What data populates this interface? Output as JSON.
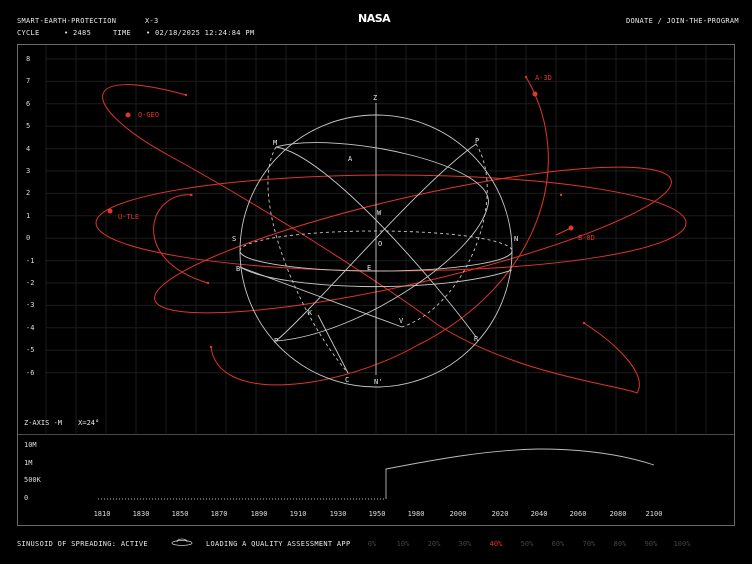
{
  "header": {
    "app_title": "SMART-EARTH-PROTECTION",
    "code": "X-3",
    "cycle_label": "CYCLE",
    "cycle_value": "• 2485",
    "time_label": "TIME",
    "time_value": "• 02/18/2025 12:24:84 PM",
    "logo": "NASA",
    "donate": "DONATE",
    "separator": "/",
    "join": "JOIN-THE-PROGRAM"
  },
  "plot": {
    "y_ticks": [
      "8",
      "7",
      "6",
      "5",
      "4",
      "3",
      "2",
      "1",
      "0",
      "-1",
      "-2",
      "-3",
      "-4",
      "-5",
      "-6"
    ],
    "sphere_labels": [
      "Z",
      "M",
      "P",
      "A",
      "N",
      "S",
      "O",
      "B",
      "E",
      "K",
      "V",
      "P",
      "R",
      "C",
      "N'",
      "W"
    ],
    "orbit_labels": [
      "Q-GEO",
      "A-3D",
      "U-TLE",
      "B-0D"
    ],
    "axis_info_label": "Z-AXIS -M",
    "axis_info_value": "X=24°"
  },
  "timeline": {
    "value_labels": [
      "10M",
      "1M",
      "500K",
      "0"
    ],
    "years": [
      "1810",
      "1830",
      "1850",
      "1870",
      "1890",
      "1910",
      "1930",
      "1950",
      "1980",
      "2000",
      "2020",
      "2040",
      "2060",
      "2080",
      "2100"
    ]
  },
  "footer": {
    "status": "SINUSOID OF SPREADING: ACTIVE",
    "loading": "LOADING A QUALITY ASSESSMENT APP",
    "percentages": [
      "0%",
      "10%",
      "20%",
      "30%",
      "40%",
      "50%",
      "60%",
      "70%",
      "80%",
      "90%",
      "100%"
    ],
    "active_percentage": "40%"
  },
  "colors": {
    "background": "#000000",
    "line": "#c8c8c8",
    "accent": "#e0362b",
    "grid": "#1c1c1c"
  }
}
